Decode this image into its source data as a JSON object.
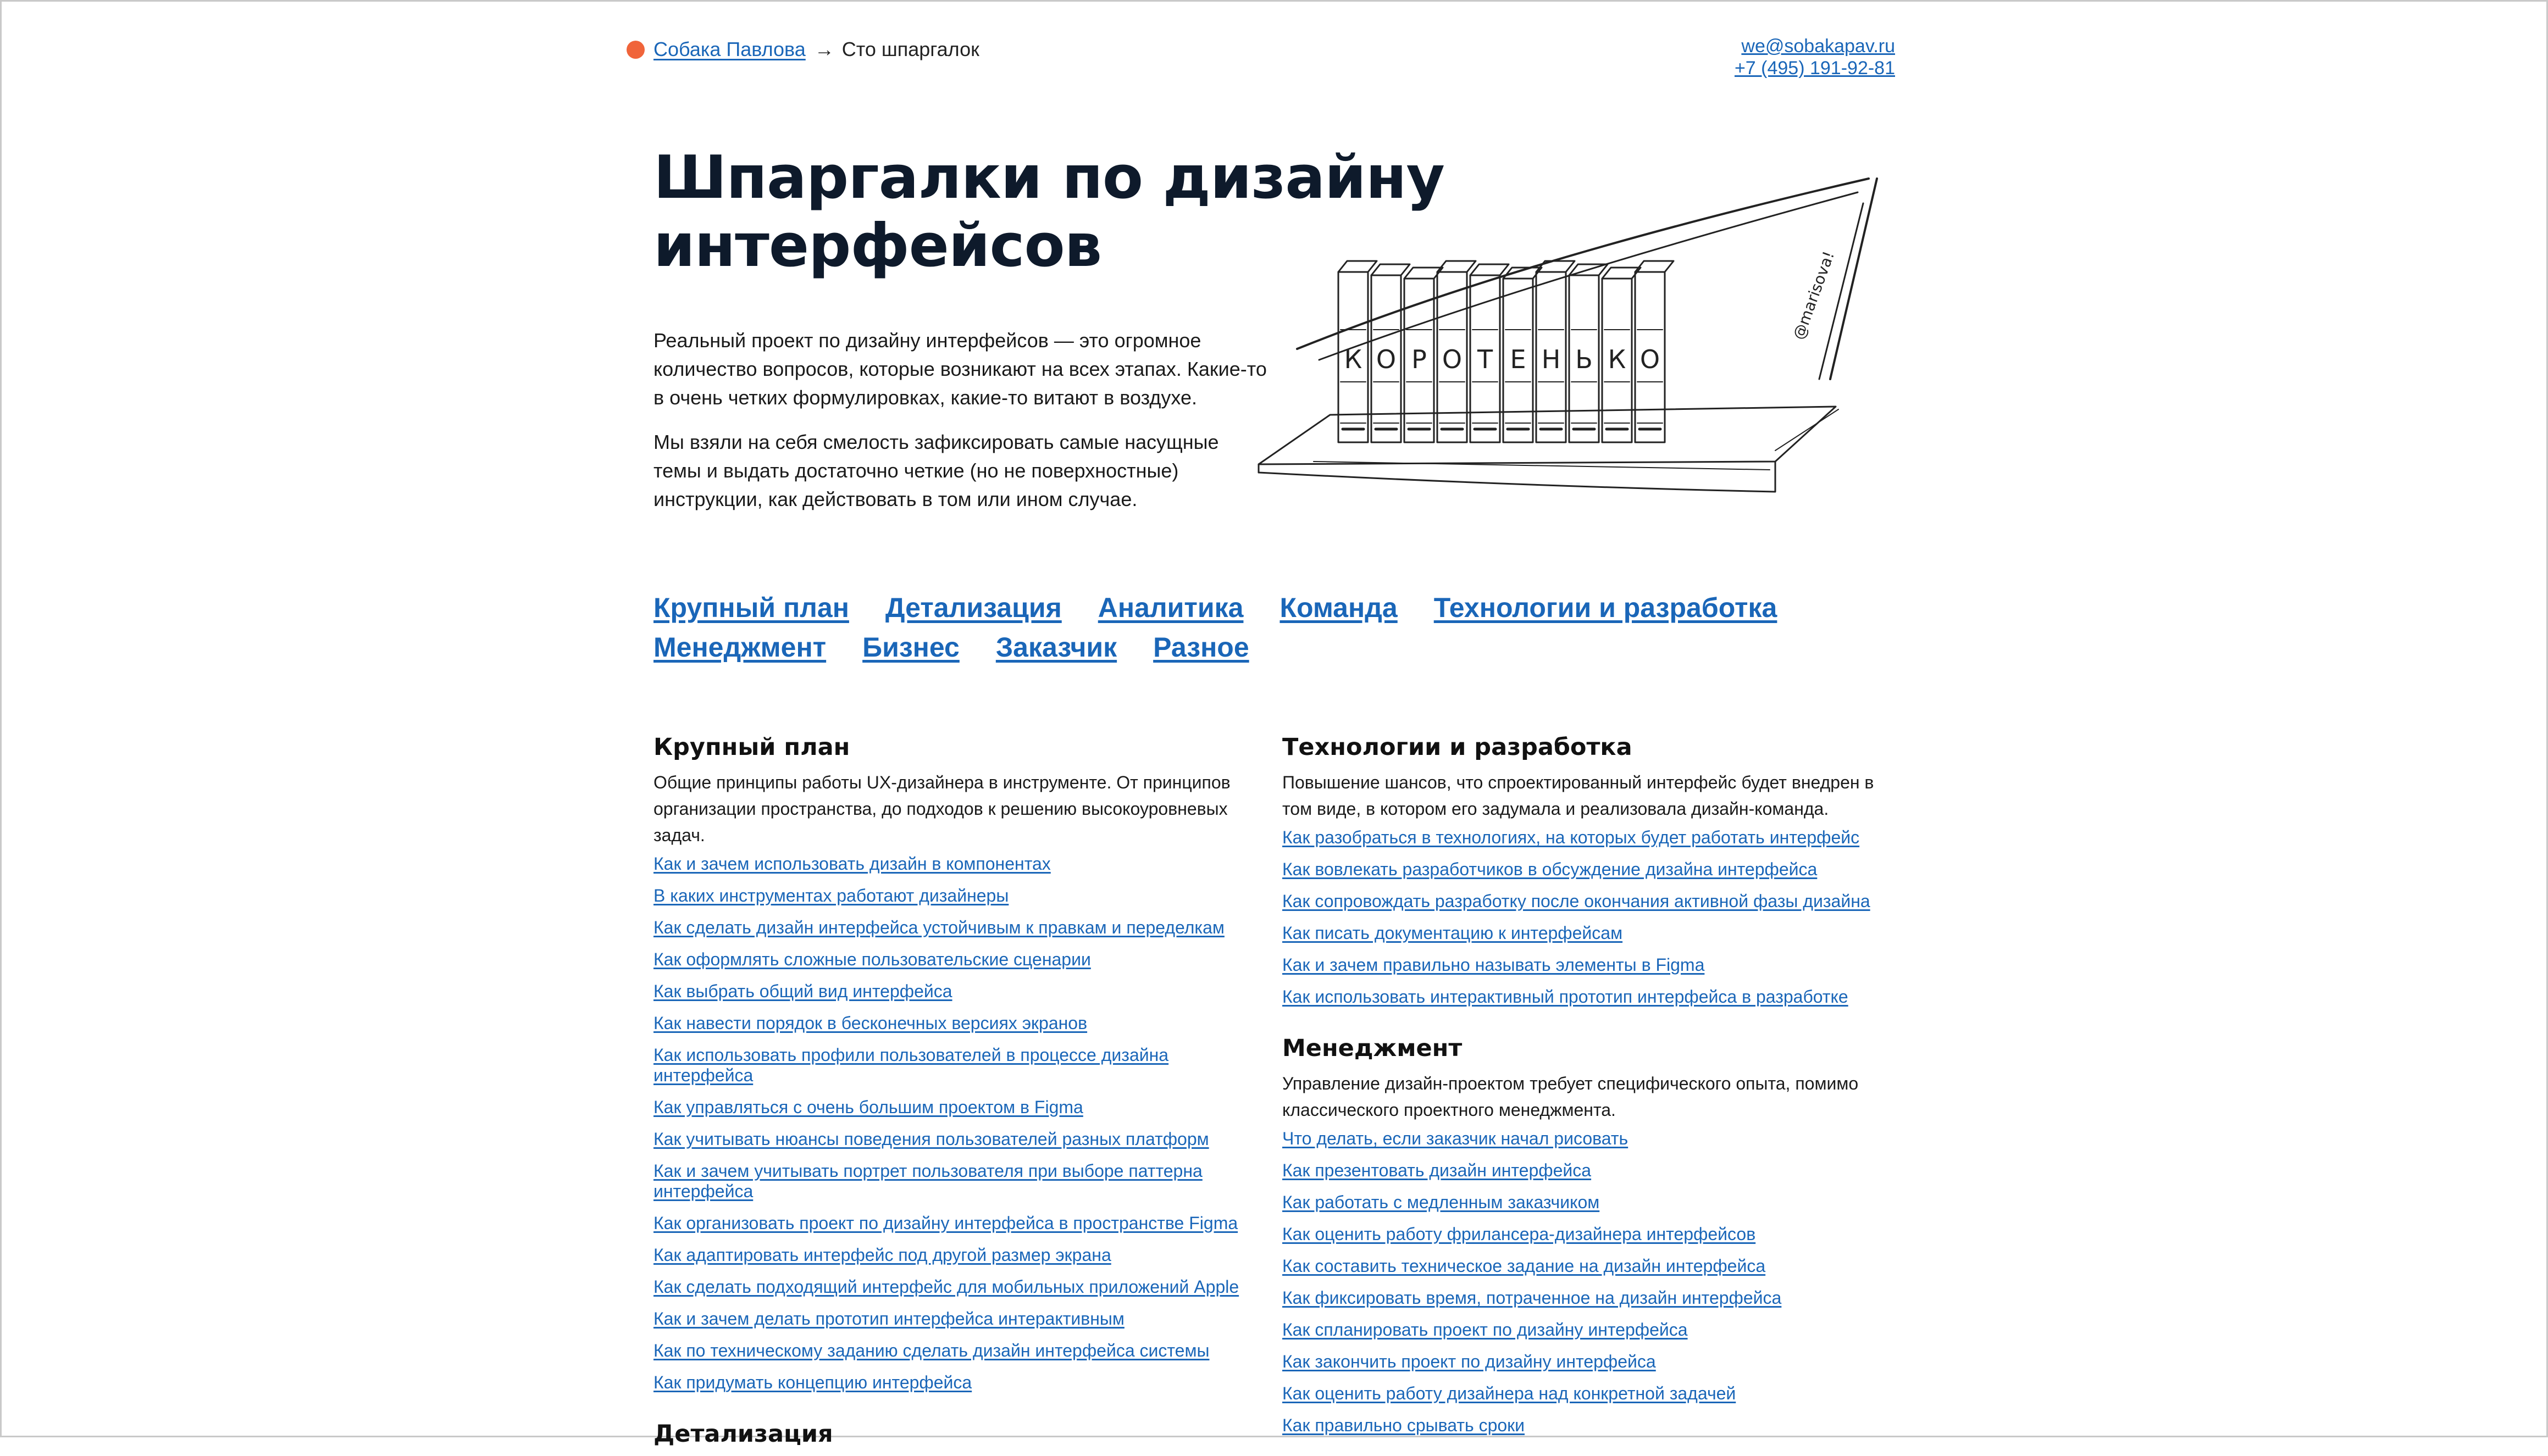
{
  "breadcrumb": {
    "home_label": "Собака Павлова",
    "separator": "→",
    "current": "Сто шпаргалок"
  },
  "contacts": {
    "email": "we@sobakapav.ru",
    "phone": "+7 (495) 191-92-81"
  },
  "hero": {
    "title": "Шпаргалки по дизайну интерфейсов",
    "paragraph_1": "Реальный проект по дизайну интерфейсов — это огромное количество вопросов, которые возникают на всех этапах. Какие-то в очень четких формулировках, какие-то витают в воздухе.",
    "paragraph_2": "Мы взяли на себя смелость зафиксировать самые насущные темы и выдать достаточно четкие (но не поверхностные) инструкции, как действовать в том или ином случае."
  },
  "illustration": {
    "book_letters": [
      "К",
      "О",
      "Р",
      "О",
      "Т",
      "Е",
      "Н",
      "Ь",
      "К",
      "О"
    ],
    "signature": "@marisova!"
  },
  "nav": {
    "items": [
      "Крупный план",
      "Детализация",
      "Аналитика",
      "Команда",
      "Технологии и разработка",
      "Менеджмент",
      "Бизнес",
      "Заказчик",
      "Разное"
    ]
  },
  "sections": {
    "big_plan": {
      "title": "Крупный план",
      "description": "Общие принципы работы UX-дизайнера в инструменте. От принципов организации пространства, до подходов к решению высокоуровневых задач.",
      "links": [
        "Как и зачем использовать дизайн в компонентах",
        "В каких инструментах работают дизайнеры",
        "Как сделать дизайн интерфейса устойчивым к правкам и переделкам",
        "Как оформлять сложные пользовательские сценарии",
        "Как выбрать общий вид интерфейса",
        "Как навести порядок в бесконечных версиях экранов",
        "Как использовать профили пользователей в процессе дизайна интерфейса",
        "Как управляться с очень большим проектом в Figma",
        "Как учитывать нюансы поведения пользователей разных платформ",
        "Как и зачем учитывать портрет пользователя при выборе паттерна интерфейса",
        "Как организовать проект по дизайну интерфейса в пространстве Figma",
        "Как адаптировать интерфейс под другой размер экрана",
        "Как сделать подходящий интерфейс для мобильных приложений Apple",
        "Как и зачем делать прототип интерфейса интерактивным",
        "Как по техническому заданию сделать дизайн интерфейса системы",
        "Как придумать концепцию интерфейса"
      ]
    },
    "detail_heading": "Детализация",
    "tech": {
      "title": "Технологии и разработка",
      "description": "Повышение шансов, что спроектированный интерфейс будет внедрен в том виде, в котором его задумала и реализовала дизайн-команда.",
      "links": [
        "Как разобраться в технологиях, на которых будет работать интерфейс",
        "Как вовлекать разработчиков в обсуждение дизайна интерфейса",
        "Как сопровождать разработку после окончания активной фазы дизайна",
        "Как писать документацию к интерфейсам",
        "Как и зачем правильно называть элементы в Figma",
        "Как использовать интерактивный прототип интерфейса в разработке"
      ]
    },
    "management": {
      "title": "Менеджмент",
      "description": "Управление дизайн-проектом требует специфического опыта, помимо классического проектного менеджмента.",
      "links": [
        "Что делать, если заказчик начал рисовать",
        "Как презентовать дизайн интерфейса",
        "Как работать с медленным заказчиком",
        "Как оценить работу фрилансера-дизайнера интерфейсов",
        "Как составить техническое задание на дизайн интерфейса",
        "Как фиксировать время, потраченное на дизайн интерфейса",
        "Как спланировать проект по дизайну интерфейса",
        "Как закончить проект по дизайну интерфейса",
        "Как оценить работу дизайнера над конкретной задачей",
        "Как правильно срывать сроки"
      ]
    }
  }
}
